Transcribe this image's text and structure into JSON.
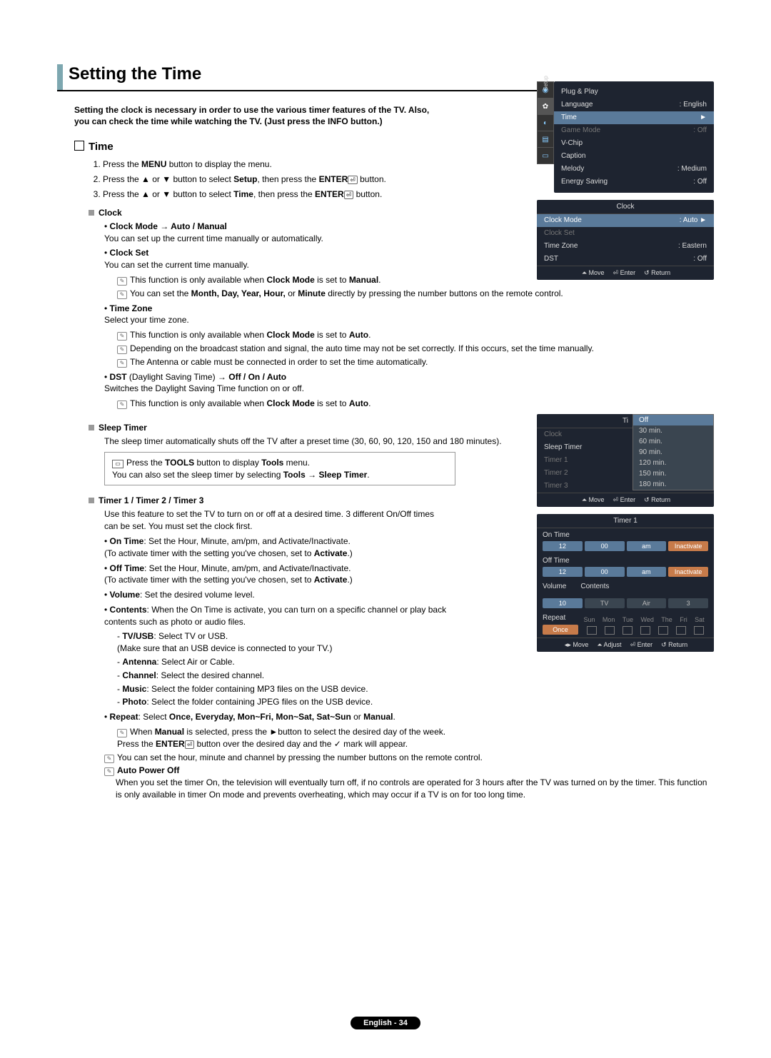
{
  "title": "Setting the Time",
  "intro": "Setting the clock is necessary in order to use the various timer features of the TV. Also, you can check the time while watching the TV. (Just press the INFO button.)",
  "sec_time": "Time",
  "steps": [
    "Press the <b>MENU</b> button to display the menu.",
    "Press the ▲ or ▼ button to select <b>Setup</b>, then press the <b>ENTER</b><span class=\"enter-ico\">⏎</span> button.",
    "Press the ▲ or ▼ button to select <b>Time</b>, then press the <b>ENTER</b><span class=\"enter-ico\">⏎</span> button."
  ],
  "clock_h": "Clock",
  "clock_mode_l": "Clock Mode → Auto / Manual",
  "clock_mode_d": "You can set up the current time manually or automatically.",
  "clock_set_l": "Clock Set",
  "clock_set_d": "You can set the current time manually.",
  "clock_set_n1": "This function is only available when <b>Clock Mode</b> is set to <b>Manual</b>.",
  "clock_set_n2": "You can set the <b>Month, Day, Year, Hour,</b> or <b>Minute</b> directly by pressing the number buttons on the remote control.",
  "tz_l": "Time Zone",
  "tz_d": "Select your time zone.",
  "tz_n1": "This function is only available when <b>Clock Mode</b> is set to <b>Auto</b>.",
  "tz_n2": "Depending on the broadcast station and signal, the auto time may not be set correctly. If this occurs, set the time manually.",
  "tz_n3": "The Antenna or cable must be connected in order to set the time automatically.",
  "dst_l": "<b>DST</b> (Daylight Saving Time) → <b>Off / On / Auto</b>",
  "dst_d": "Switches the Daylight Saving Time function on or off.",
  "dst_n": "This function is only available when <b>Clock Mode</b> is set to <b>Auto</b>.",
  "sleep_h": "Sleep Timer",
  "sleep_d": "The sleep timer automatically shuts off the TV after a preset time (30, 60, 90, 120, 150 and 180 minutes).",
  "sleep_tn": "Press the <b>TOOLS</b> button to display <b>Tools</b> menu.<br>You can also set the sleep timer by selecting <b>Tools → Sleep Timer</b>.",
  "tim_h": "Timer 1 / Timer 2 / Timer 3",
  "tim_d": "Use this feature to set the TV to turn on or off at a desired time. 3 different On/Off times can be set. You must set the clock first.",
  "on_l": "<b>On Time</b>: Set the Hour, Minute, am/pm, and Activate/Inactivate.<br>(To activate timer with the setting you've chosen, set to <b>Activate</b>.)",
  "off_l": "<b>Off Time</b>: Set the Hour, Minute, am/pm, and Activate/Inactivate.<br>(To activate timer with the setting you've chosen, set to <b>Activate</b>.)",
  "vol_l": "<b>Volume</b>: Set the desired volume level.",
  "con_l": "<b>Contents</b>: When the On Time is activate, you can turn on a specific channel or play back contents such as photo or audio files.",
  "con_tv": "<b>TV/USB</b>: Select TV or USB.<br>(Make sure that an USB device is connected to your TV.)",
  "con_ant": "<b>Antenna</b>: Select Air or Cable.",
  "con_ch": "<b>Channel</b>: Select the desired channel.",
  "con_mu": "<b>Music</b>: Select the folder containing MP3 files on the USB device.",
  "con_ph": "<b>Photo</b>: Select the folder containing JPEG files on the USB device.",
  "rep_l": "<b>Repeat</b>: Select <b>Once, Everyday, Mon~Fri, Mon~Sat, Sat~Sun</b> or <b>Manual</b>.",
  "rep_n": "When <b>Manual</b> is selected, press the ►button to select the desired day of the week.<br>Press the <b>ENTER</b><span class=\"enter-ico\">⏎</span> button over the desired day and the ✓ mark will appear.",
  "foot_n": "You can set the hour, minute and channel by pressing the number buttons on the remote control.",
  "auto_l": "Auto Power Off",
  "auto_d": "When you set the timer On, the television will eventually turn off, if no controls are operated for 3 hours after the TV was turned on by the timer. This function is only available in timer On mode and prevents overheating, which may occur if a TV is on for too long time.",
  "page_no": "English - 34",
  "setup_menu": {
    "side": "Setup",
    "items": [
      {
        "l": "Plug & Play",
        "r": ""
      },
      {
        "l": "Language",
        "r": ": English"
      },
      {
        "l": "Time",
        "r": "►",
        "a": true
      },
      {
        "l": "Game Mode",
        "r": ": Off",
        "d": true
      },
      {
        "l": "V-Chip",
        "r": ""
      },
      {
        "l": "Caption",
        "r": ""
      },
      {
        "l": "Melody",
        "r": ": Medium"
      },
      {
        "l": "Energy Saving",
        "r": ": Off"
      }
    ]
  },
  "clock_menu": {
    "title": "Clock",
    "rows": [
      {
        "l": "Clock Mode",
        "r": ": Auto",
        "a": true
      },
      {
        "l": "Clock Set",
        "r": "",
        "d": true
      },
      {
        "l": "Time Zone",
        "r": ": Eastern"
      },
      {
        "l": "DST",
        "r": ": Off"
      }
    ],
    "foot": [
      "⏶ Move",
      "⏎ Enter",
      "↺ Return"
    ]
  },
  "time_menu": {
    "title": "Ti",
    "rows": [
      {
        "l": "Clock",
        "r": "",
        "d": true
      },
      {
        "l": "Sleep Timer",
        "r": ": Off"
      },
      {
        "l": "Timer 1",
        "r": "",
        "d": true
      },
      {
        "l": "Timer 2",
        "r": "",
        "d": true
      },
      {
        "l": "Timer 3",
        "r": "",
        "d": true
      }
    ],
    "popup": [
      "Off",
      "30 min.",
      "60 min.",
      "90 min.",
      "120 min.",
      "150 min.",
      "180 min."
    ],
    "foot": [
      "⏶ Move",
      "⏎ Enter",
      "↺ Return"
    ]
  },
  "timer1": {
    "title": "Timer 1",
    "on": "On Time",
    "off": "Off Time",
    "on_btns": [
      "12",
      "00",
      "am",
      "Inactivate"
    ],
    "off_btns": [
      "12",
      "00",
      "am",
      "Inactivate"
    ],
    "vol": "Volume",
    "con": "Contents",
    "vol_btns": [
      "10",
      "TV",
      "Air",
      "3"
    ],
    "rep": "Repeat",
    "rep_btn": "Once",
    "days": [
      "Sun",
      "Mon",
      "Tue",
      "Wed",
      "The",
      "Fri",
      "Sat"
    ],
    "foot": [
      "◂▸ Move",
      "⏶ Adjust",
      "⏎ Enter",
      "↺ Return"
    ]
  }
}
